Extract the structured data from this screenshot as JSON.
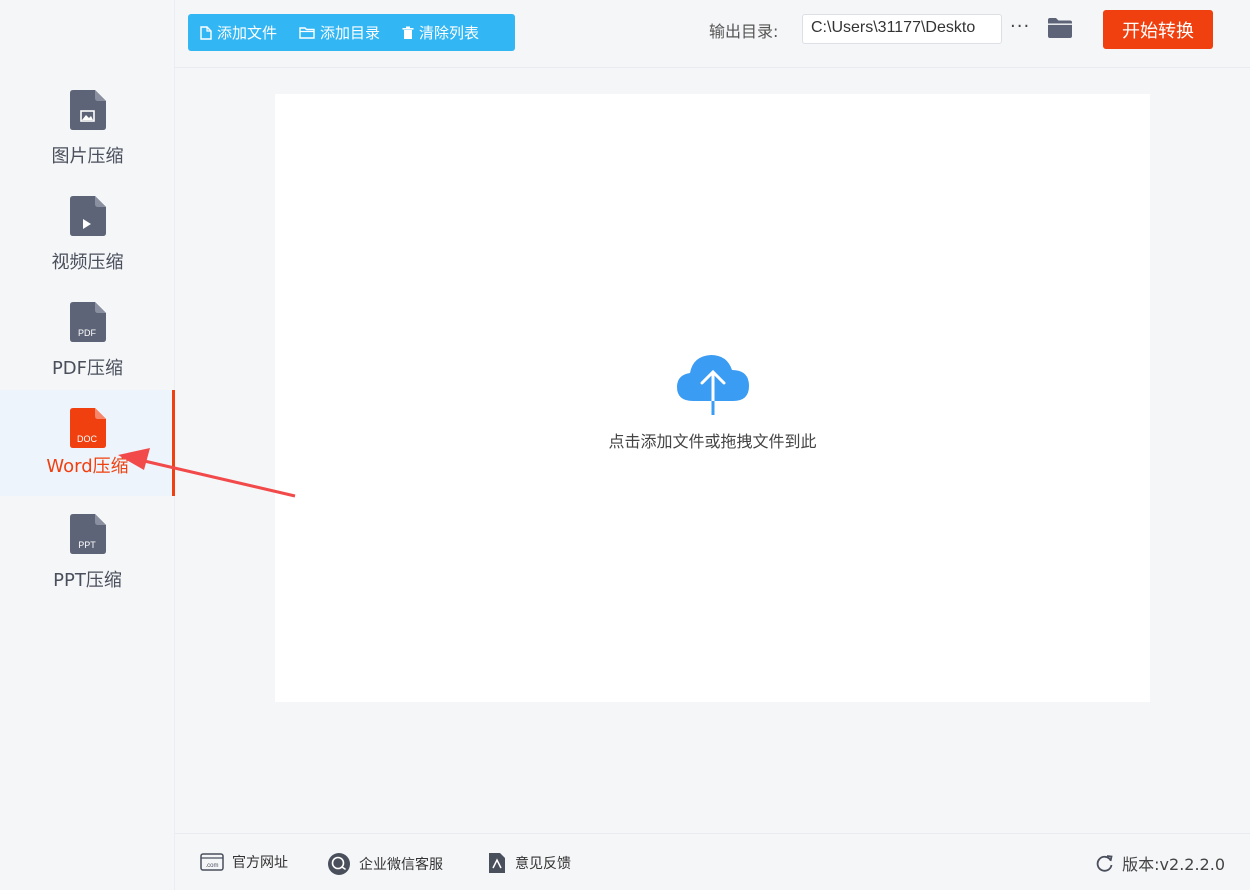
{
  "sidebar": {
    "items": [
      {
        "label": "图片压缩",
        "icon": "image-file-icon",
        "badge": ""
      },
      {
        "label": "视频压缩",
        "icon": "video-file-icon",
        "badge": ""
      },
      {
        "label": "PDF压缩",
        "icon": "pdf-file-icon",
        "badge": "PDF"
      },
      {
        "label": "Word压缩",
        "icon": "doc-file-icon",
        "badge": "DOC",
        "active": true
      },
      {
        "label": "PPT压缩",
        "icon": "ppt-file-icon",
        "badge": "PPT"
      }
    ]
  },
  "toolbar": {
    "add_file": "添加文件",
    "add_dir": "添加目录",
    "clear_list": "清除列表"
  },
  "output": {
    "label": "输出目录:",
    "path": "C:\\Users\\31177\\Deskto",
    "more": "···"
  },
  "start_button": "开始转换",
  "dropzone": {
    "text": "点击添加文件或拖拽文件到此"
  },
  "footer": {
    "website": "官方网址",
    "wechat": "企业微信客服",
    "feedback": "意见反馈",
    "version": "版本:v2.2.2.0"
  },
  "colors": {
    "accent": "#f0400f",
    "toolbar": "#33b7f4",
    "icon_gray": "#5d6477",
    "cloud": "#3a9cf2"
  }
}
